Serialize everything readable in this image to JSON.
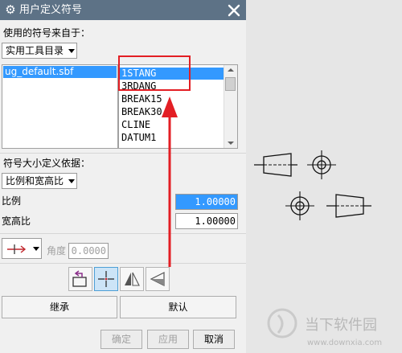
{
  "dialog": {
    "title": "用户定义符号",
    "icons": {
      "title": "gear-icon",
      "close": "close-icon"
    },
    "source_label": "使用的符号来自于：",
    "source_select": {
      "value": "实用工具目录"
    },
    "library_list": {
      "items": [
        "ug_default.sbf"
      ],
      "selected": "ug_default.sbf"
    },
    "symbol_list": {
      "items": [
        "1STANG",
        "3RDANG",
        "BREAK15",
        "BREAK30",
        "CLINE",
        "DATUM1"
      ],
      "selected": "1STANG"
    },
    "size_label": "符号大小定义依据：",
    "size_select": {
      "value": "比例和宽高比"
    },
    "scale_label": "比例",
    "scale_value": "1.00000",
    "aspect_label": "宽高比",
    "aspect_value": "1.00000",
    "angle_label": "角度",
    "angle_value": "0.0000",
    "orientation_icons": [
      "leader-arrow-icon",
      "edit-icon",
      "crosshair-icon",
      "mirror-icon",
      "flip-icon"
    ],
    "inherit_button": "继承",
    "default_button": "默认",
    "ok_button": "确定",
    "apply_button": "应用",
    "cancel_button": "取消"
  },
  "watermark": {
    "name": "当下软件园",
    "url": "www.downxia.com"
  },
  "colors": {
    "titlebar": "#5d7286",
    "selection": "#3399ff",
    "annotation": "#e31e24",
    "canvas": "#e6e6e6"
  }
}
